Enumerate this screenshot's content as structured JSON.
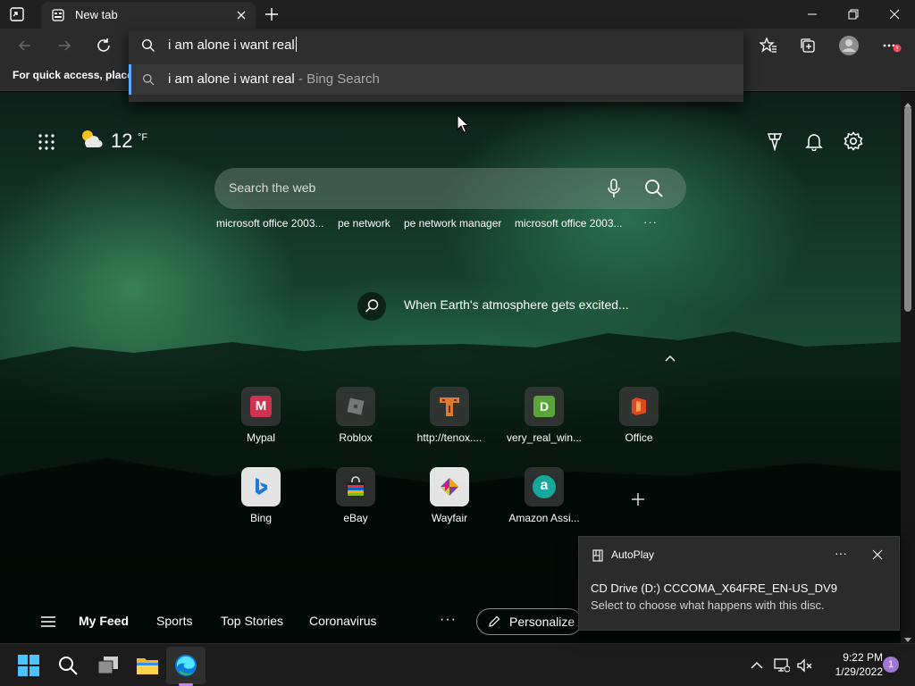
{
  "browser": {
    "tab_title": "New tab",
    "favorites_bar_text": "For quick access, place y"
  },
  "address": {
    "typed_text": "i am alone i want real",
    "suggestion_query": "i am alone i want real",
    "suggestion_source": " - Bing Search"
  },
  "ntp": {
    "temperature": "12",
    "temperature_unit": "°F",
    "search_placeholder": "Search the web",
    "quick_links": [
      "microsoft office 2003...",
      "pe network",
      "pe network manager",
      "microsoft office 2003..."
    ],
    "quick_links_more": "···",
    "image_caption": "When Earth's atmosphere gets excited...",
    "tiles": [
      {
        "label": "Mypal",
        "icon": "mypal-icon",
        "letter": "M",
        "color": "#d1324f"
      },
      {
        "label": "Roblox",
        "icon": "roblox-icon",
        "color": "#6d6d6d"
      },
      {
        "label": "http://tenox....",
        "icon": "tenox-icon",
        "color": "#e07a2e"
      },
      {
        "label": "very_real_win...",
        "icon": "very-real-icon",
        "letter": "D",
        "color": "#5aa43a"
      },
      {
        "label": "Office",
        "icon": "office-icon",
        "color": "#e3461f"
      },
      {
        "label": "Bing",
        "icon": "bing-icon",
        "color": "#1f7ad6"
      },
      {
        "label": "eBay",
        "icon": "ebay-icon",
        "color": "#e53238"
      },
      {
        "label": "Wayfair",
        "icon": "wayfair-icon",
        "color": "#7b3fa0"
      },
      {
        "label": "Amazon Assi...",
        "icon": "amazon-assistant-icon",
        "letter": "a",
        "color": "#16a89a"
      }
    ],
    "feed_tabs": [
      "My Feed",
      "Sports",
      "Top Stories",
      "Coronavirus"
    ],
    "feed_more": "···",
    "personalize_label": "Personalize"
  },
  "toast": {
    "app_name": "AutoPlay",
    "more": "···",
    "title": "CD Drive (D:) CCCOMA_X64FRE_EN-US_DV9",
    "body": "Select to choose what happens with this disc."
  },
  "taskbar": {
    "time": "9:22 PM",
    "date": "1/29/2022",
    "notification_count": "1"
  },
  "colors": {
    "accent": "#5fa8ff",
    "edge_indicator": "#c880ff",
    "notification_badge": "#a277d1"
  }
}
